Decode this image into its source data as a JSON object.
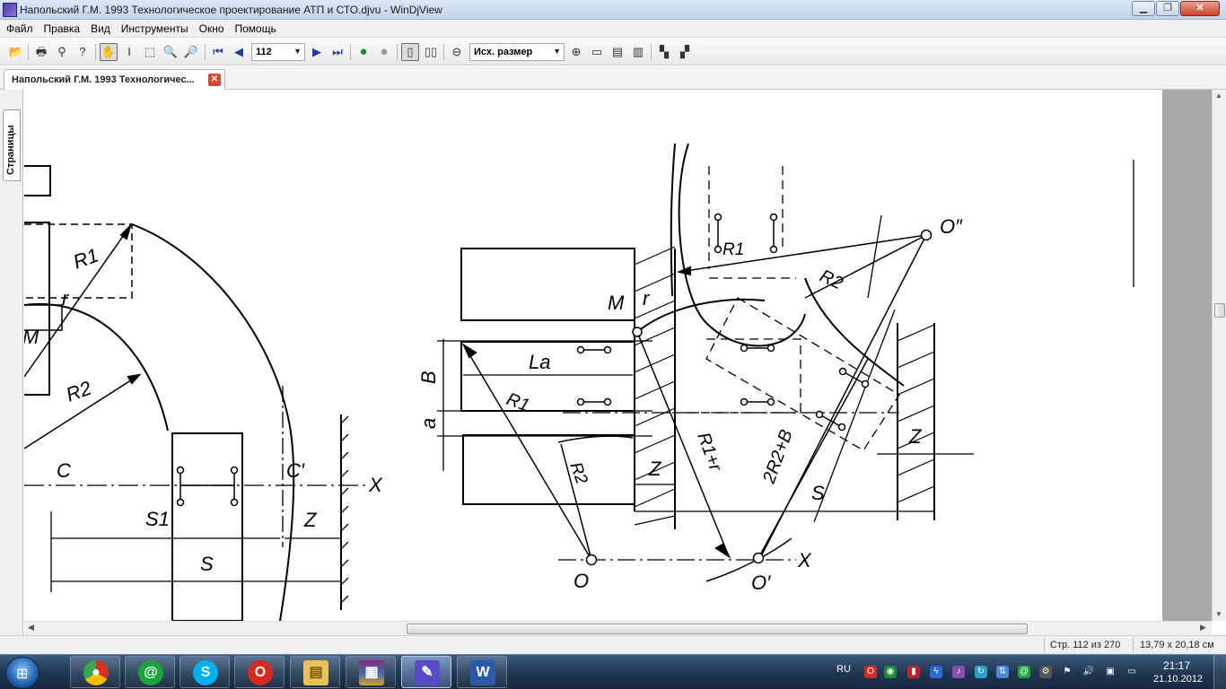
{
  "window": {
    "title": "Напольский Г.М. 1993 Технологическое проектирование АТП и СТО.djvu - WinDjView",
    "min": "▁",
    "max": "❐",
    "close": "✕"
  },
  "menu": {
    "file": "Файл",
    "edit": "Правка",
    "view": "Вид",
    "tools": "Инструменты",
    "window": "Окно",
    "help": "Помощь"
  },
  "toolbar": {
    "page_number": "112",
    "zoom": "Исх. размер"
  },
  "tab": {
    "label": "Напольский Г.М. 1993 Технологичес...",
    "close": "✕"
  },
  "sidebar": {
    "pages_tab": "Страницы"
  },
  "drawing": {
    "left": {
      "r1": "R1",
      "r": "r",
      "m": "M",
      "r2": "R2",
      "c": "C",
      "c_prime": "C′",
      "x": "X",
      "s1": "S1",
      "z": "Z",
      "s": "S"
    },
    "right": {
      "o_dprime": "O″",
      "r1": "R1",
      "r2_top": "R2",
      "m": "M",
      "r": "r",
      "la": "La",
      "b": "B",
      "a": "a",
      "r1_mid": "R1",
      "r2_low": "R2",
      "z1": "Z",
      "r1r": "R1+r",
      "two_r2_b": "2R2+B",
      "s": "S",
      "z2": "Z",
      "o": "O",
      "o_prime": "O′",
      "x": "X"
    }
  },
  "status": {
    "page": "Стр. 112 из 270",
    "size": "13,79 x 20,18 см"
  },
  "taskbar": {
    "lang": "RU",
    "time": "21:17",
    "date": "21.10.2012"
  },
  "colors": {
    "accent": "#1f5fa8",
    "close_red": "#c8442a",
    "taskbar": "#1e3550"
  }
}
